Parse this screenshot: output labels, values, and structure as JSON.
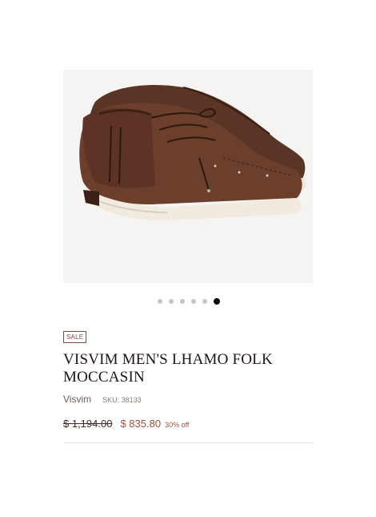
{
  "gallery": {
    "image_alt": "Brown suede moccasin sneakers with leather laces and cream rubber soles",
    "dot_count": 6,
    "active_index": 5
  },
  "product": {
    "badge": "SALE",
    "title": "VISVIM MEN'S LHAMO FOLK MOCCASIN",
    "brand": "Visvim",
    "sku": "SKU: 38133",
    "original_price": "$ 1,194.00",
    "sale_price": "$ 835.80",
    "discount": "30% off"
  },
  "colors": {
    "sale_accent": "#9a5140",
    "active_dot": "#000000",
    "inactive_dot": "#c9c4c1"
  }
}
